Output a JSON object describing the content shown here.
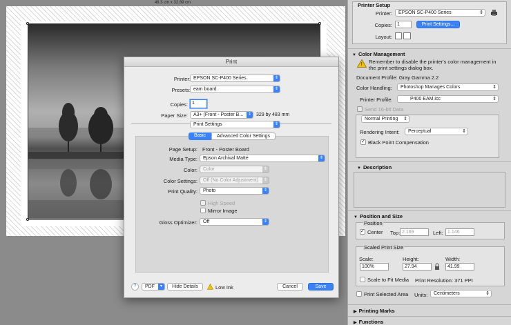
{
  "canvas": {
    "dimensions_label": "48.3 cm x 32.89 cm"
  },
  "print_dialog": {
    "title": "Print",
    "printer_label": "Printer:",
    "printer_value": "EPSON SC-P400 Series",
    "presets_label": "Presets:",
    "presets_value": "eam board",
    "copies_label": "Copies:",
    "copies_value": "1",
    "paper_size_label": "Paper Size:",
    "paper_size_value": "A3+ (Front - Poster B...",
    "paper_size_dims": "329 by 483 mm",
    "section_popup": "Print Settings",
    "tabs": [
      "Basic",
      "Advanced Color Settings"
    ],
    "page_setup_label": "Page Setup:",
    "page_setup_value": "Front - Poster Board",
    "media_type_label": "Media Type:",
    "media_type_value": "Epson Archival Matte",
    "color_label": "Color:",
    "color_value": "Color",
    "color_settings_label": "Color Settings:",
    "color_settings_value": "Off (No Color Adjustment)",
    "print_quality_label": "Print Quality:",
    "print_quality_value": "Photo",
    "high_speed_label": "High Speed",
    "mirror_image_label": "Mirror Image",
    "gloss_optimizer_label": "Gloss Optimizer:",
    "gloss_optimizer_value": "Off",
    "help_label": "?",
    "pdf_label": "PDF",
    "hide_details_label": "Hide Details",
    "low_ink_label": "Low Ink",
    "cancel_label": "Cancel",
    "save_label": "Save"
  },
  "panel": {
    "printer_setup": {
      "title": "Printer Setup",
      "printer_label": "Printer:",
      "printer_value": "EPSON SC-P400 Series",
      "copies_label": "Copies:",
      "copies_value": "1",
      "print_settings_button": "Print Settings...",
      "layout_label": "Layout:"
    },
    "color_management": {
      "title": "Color Management",
      "warning": "Remember to disable the printer's color management in the print settings dialog box.",
      "document_profile": "Document Profile: Gray Gamma 2.2",
      "color_handling_label": "Color Handling:",
      "color_handling_value": "Photoshop Manages Colors",
      "printer_profile_label": "Printer Profile:",
      "printer_profile_value": "P400 EAM.icc",
      "send_16bit_label": "Send 16-bit Data",
      "normal_printing_value": "Normal Printing",
      "rendering_intent_label": "Rendering Intent:",
      "rendering_intent_value": "Perceptual",
      "black_point_label": "Black Point Compensation"
    },
    "description": {
      "title": "Description"
    },
    "position_size": {
      "title": "Position and Size",
      "position_group": "Position",
      "center_label": "Center",
      "top_label": "Top:",
      "top_value": "2.169",
      "left_label": "Left:",
      "left_value": "1.146",
      "scaled_group": "Scaled Print Size",
      "scale_label": "Scale:",
      "scale_value": "100%",
      "height_label": "Height:",
      "height_value": "27.94",
      "width_label": "Width:",
      "width_value": "41.99",
      "scale_to_fit_label": "Scale to Fit Media",
      "print_resolution": "Print Resolution: 371 PPI",
      "print_selected_label": "Print Selected Area",
      "units_label": "Units:",
      "units_value": "Centimeters"
    },
    "printing_marks": {
      "title": "Printing Marks"
    },
    "functions": {
      "title": "Functions"
    }
  },
  "colors": {
    "accent": "#3b82f6",
    "warning": "#f2c200"
  },
  "icons": [
    "printer-icon",
    "warning-icon",
    "layout-portrait-icon",
    "layout-landscape-icon",
    "lock-icon",
    "help-icon",
    "disclosure-triangle-icon"
  ]
}
